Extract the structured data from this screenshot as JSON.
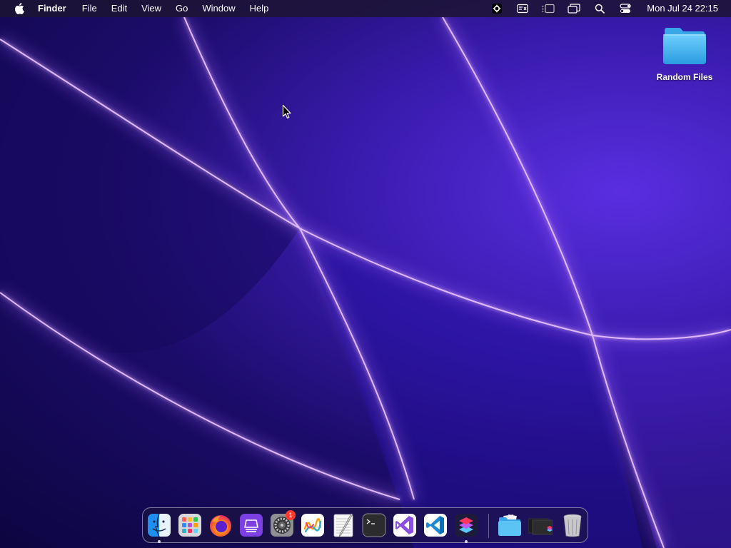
{
  "menubar": {
    "app_name": "Finder",
    "menus": [
      "File",
      "Edit",
      "View",
      "Go",
      "Window",
      "Help"
    ],
    "status_icons": [
      "gear-badge-icon",
      "keyboard-input-icon",
      "stage-manager-icon",
      "window-switcher-icon",
      "spotlight-search-icon",
      "control-center-icon"
    ],
    "clock": "Mon Jul 24  22:15"
  },
  "desktop": {
    "items": [
      {
        "label": "Random Files",
        "icon": "folder-icon"
      }
    ]
  },
  "dock": {
    "apps": [
      {
        "name": "Finder",
        "icon": "finder-icon",
        "running": true
      },
      {
        "name": "Launchpad",
        "icon": "launchpad-icon",
        "running": false
      },
      {
        "name": "Firefox",
        "icon": "firefox-icon",
        "running": false
      },
      {
        "name": "App",
        "icon": "purple-stack-app-icon",
        "running": false
      },
      {
        "name": "System Settings",
        "icon": "system-settings-icon",
        "running": false,
        "badge": "1"
      },
      {
        "name": "Freeform",
        "icon": "freeform-icon",
        "running": false
      },
      {
        "name": "TextEdit",
        "icon": "textedit-icon",
        "running": false
      },
      {
        "name": "Terminal",
        "icon": "terminal-icon",
        "running": false
      },
      {
        "name": "Visual Studio",
        "icon": "visual-studio-icon",
        "running": false
      },
      {
        "name": "Visual Studio Code",
        "icon": "vscode-icon",
        "running": false
      },
      {
        "name": "Shortcuts",
        "icon": "shortcuts-icon",
        "running": true
      }
    ],
    "stacks": [
      {
        "name": "Folder",
        "icon": "folder-stack-icon"
      },
      {
        "name": "Screenshots",
        "icon": "screenshot-stack-icon"
      },
      {
        "name": "Trash",
        "icon": "trash-icon"
      }
    ]
  },
  "colors": {
    "wallpaper_primary": "#3a1cb0",
    "wallpaper_glow": "#c58cff",
    "folder_blue": "#3fb6f0"
  }
}
